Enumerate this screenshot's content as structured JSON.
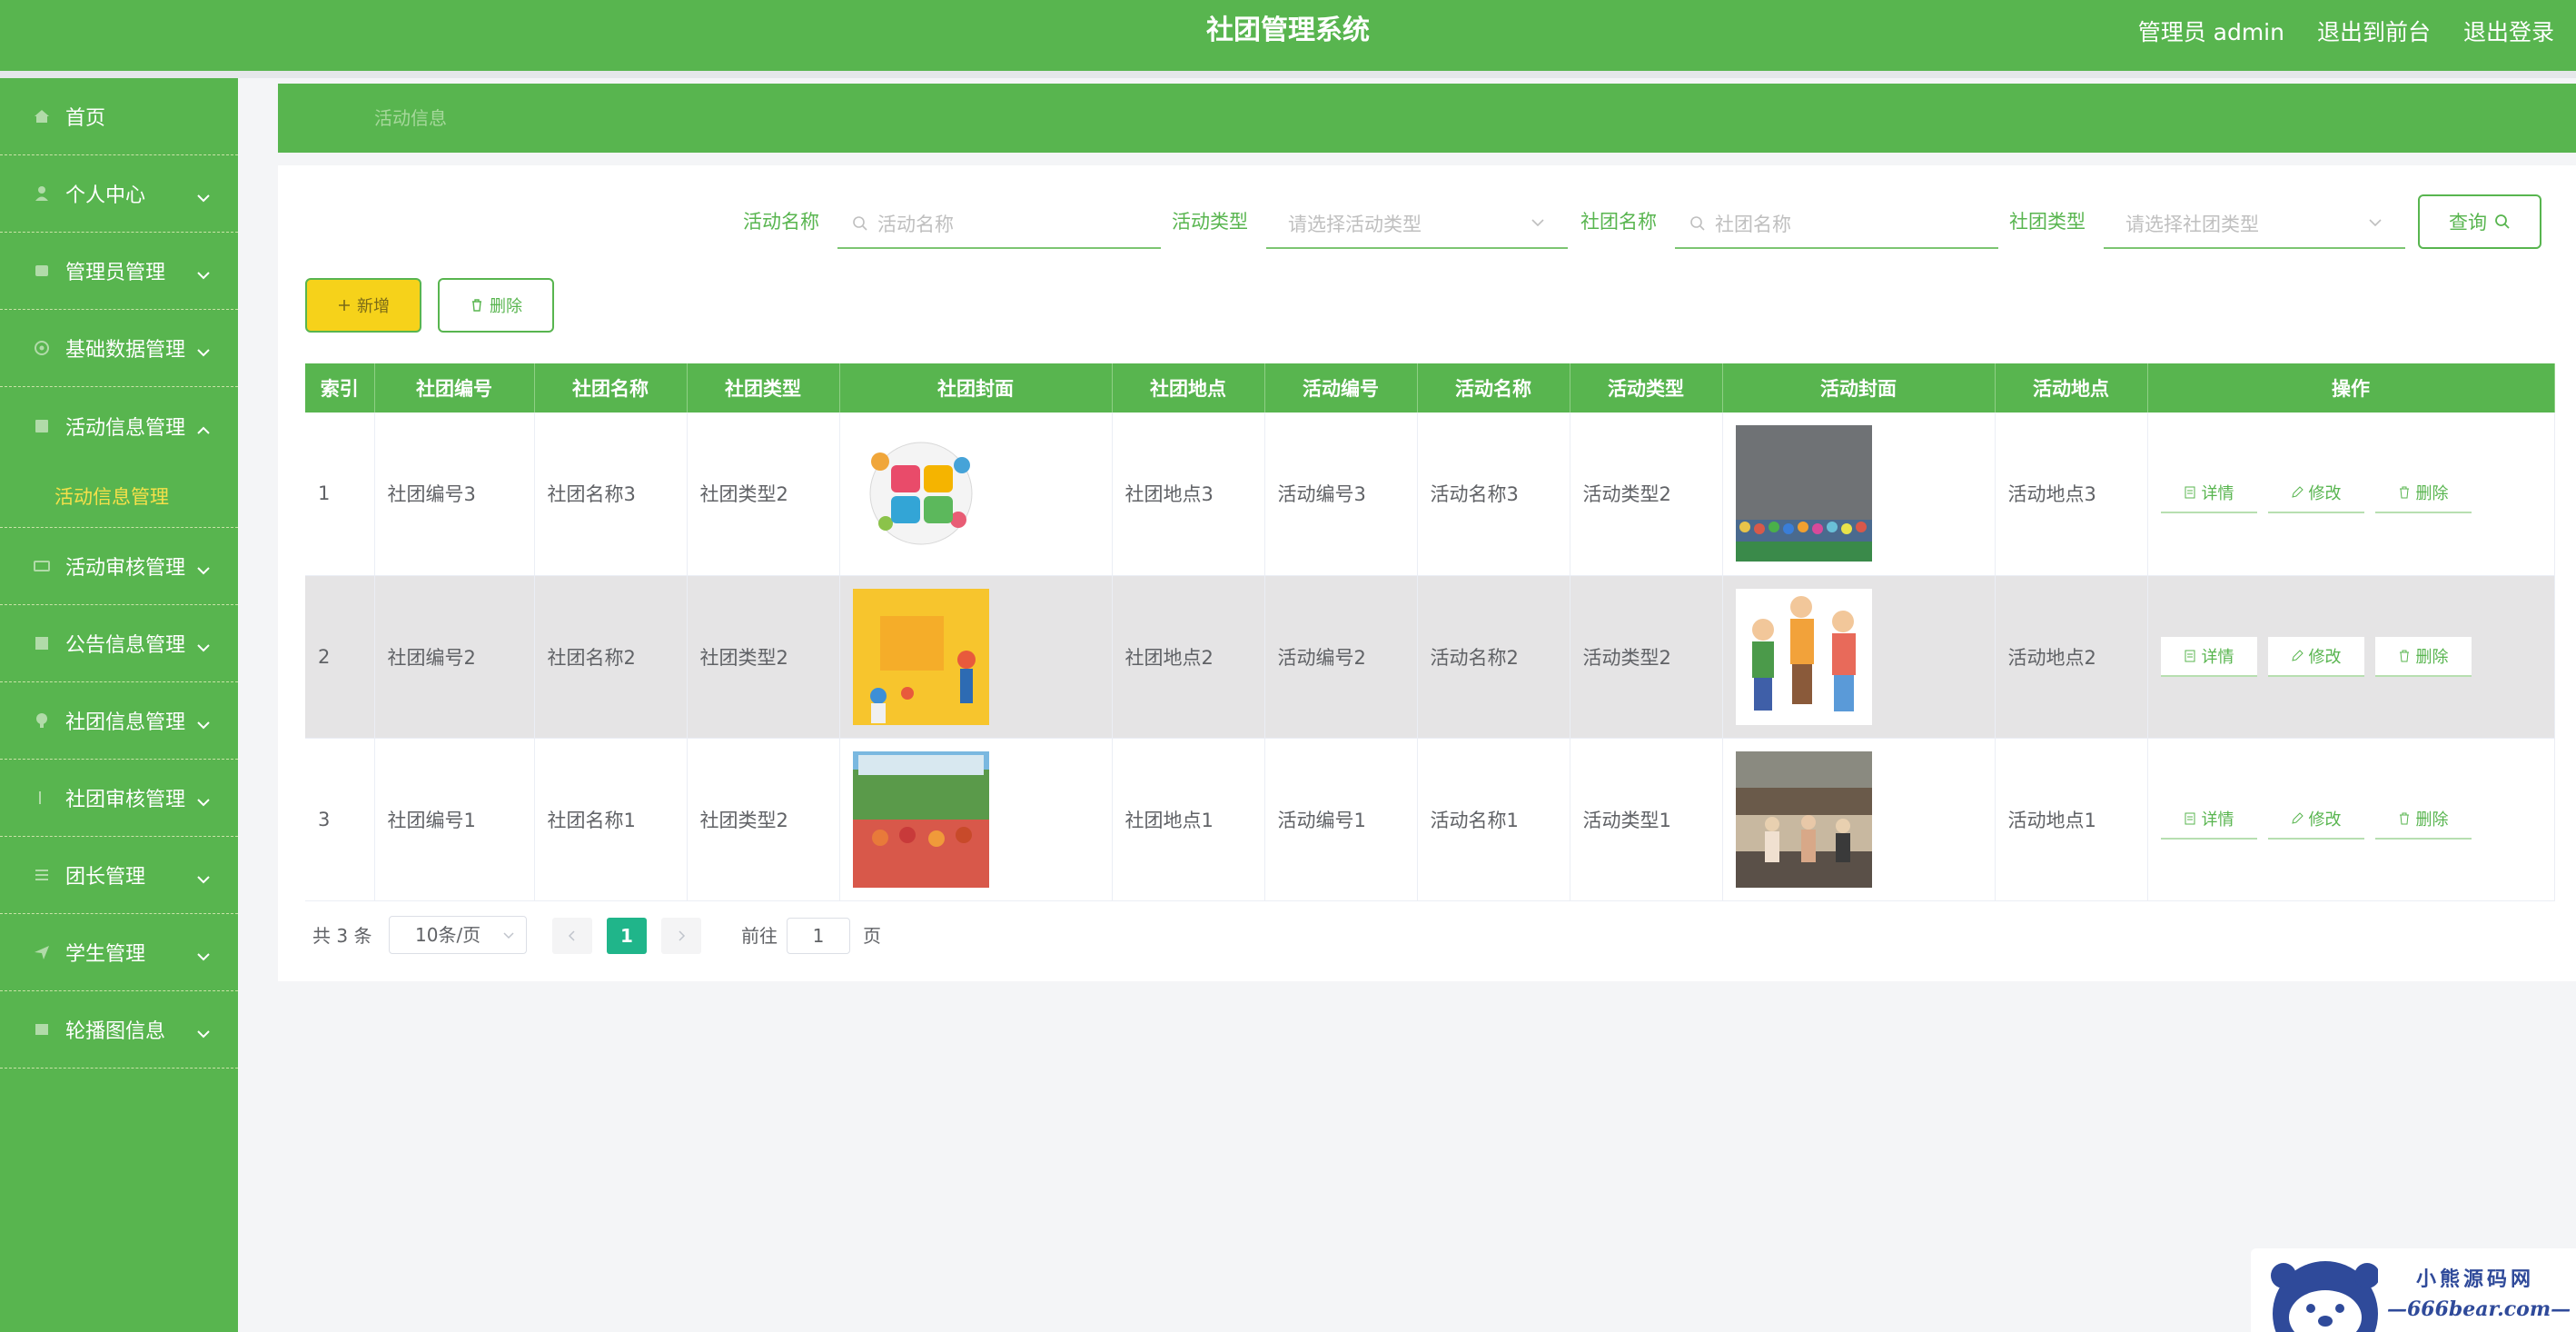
{
  "header": {
    "title": "社团管理系统",
    "user_label": "管理员 admin",
    "to_front": "退出到前台",
    "logout": "退出登录"
  },
  "sidebar": {
    "items": [
      {
        "label": "首页",
        "icon": "home-icon"
      },
      {
        "label": "个人中心",
        "icon": "user-icon"
      },
      {
        "label": "管理员管理",
        "icon": "admin-icon"
      },
      {
        "label": "基础数据管理",
        "icon": "gear-icon"
      },
      {
        "label": "活动信息管理",
        "icon": "list-icon",
        "expanded": true
      },
      {
        "label": "活动审核管理",
        "icon": "audit-icon"
      },
      {
        "label": "公告信息管理",
        "icon": "notice-icon"
      },
      {
        "label": "社团信息管理",
        "icon": "club-icon"
      },
      {
        "label": "社团审核管理",
        "icon": "check-icon"
      },
      {
        "label": "团长管理",
        "icon": "menu-icon"
      },
      {
        "label": "学生管理",
        "icon": "send-icon"
      },
      {
        "label": "轮播图信息",
        "icon": "image-icon"
      }
    ],
    "submenu_active": "活动信息管理"
  },
  "breadcrumb": "活动信息",
  "search": {
    "activity_name_label": "活动名称",
    "activity_name_placeholder": "活动名称",
    "activity_type_label": "活动类型",
    "activity_type_placeholder": "请选择活动类型",
    "club_name_label": "社团名称",
    "club_name_placeholder": "社团名称",
    "club_type_label": "社团类型",
    "club_type_placeholder": "请选择社团类型",
    "query_label": "查询"
  },
  "actions": {
    "add_label": "新增",
    "delete_label": "删除"
  },
  "table": {
    "columns": [
      "索引",
      "社团编号",
      "社团名称",
      "社团类型",
      "社团封面",
      "社团地点",
      "活动编号",
      "活动名称",
      "活动类型",
      "活动封面",
      "活动地点",
      "操作"
    ],
    "rows": [
      {
        "index": "1",
        "club_no": "社团编号3",
        "club_name": "社团名称3",
        "club_type": "社团类型2",
        "club_place": "社团地点3",
        "act_no": "活动编号3",
        "act_name": "活动名称3",
        "act_type": "活动类型2",
        "act_place": "活动地点3"
      },
      {
        "index": "2",
        "club_no": "社团编号2",
        "club_name": "社团名称2",
        "club_type": "社团类型2",
        "club_place": "社团地点2",
        "act_no": "活动编号2",
        "act_name": "活动名称2",
        "act_type": "活动类型2",
        "act_place": "活动地点2"
      },
      {
        "index": "3",
        "club_no": "社团编号1",
        "club_name": "社团名称1",
        "club_type": "社团类型2",
        "club_place": "社团地点1",
        "act_no": "活动编号1",
        "act_name": "活动名称1",
        "act_type": "活动类型1",
        "act_place": "活动地点1"
      }
    ],
    "op_detail": "详情",
    "op_edit": "修改",
    "op_delete": "删除"
  },
  "pagination": {
    "total": "共 3 条",
    "page_size": "10条/页",
    "current": "1",
    "goto_prefix": "前往",
    "goto_value": "1",
    "goto_suffix": "页"
  },
  "watermark": {
    "line1": "小熊源码网",
    "line2": "—666bear.com—"
  },
  "colors": {
    "brand": "#58b54f",
    "accent_yellow": "#f6d21a",
    "pager_active": "#20b58a"
  }
}
